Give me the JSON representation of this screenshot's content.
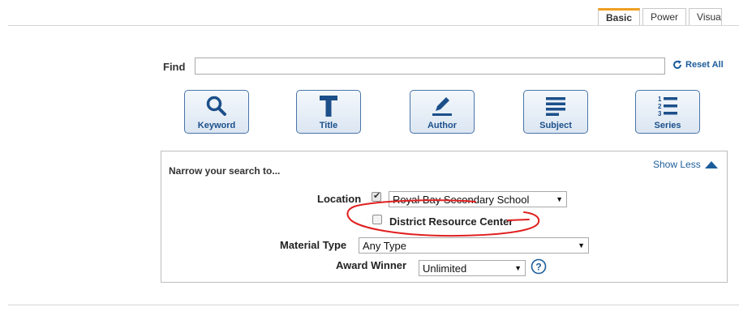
{
  "tabs": [
    {
      "label": "Basic",
      "active": true
    },
    {
      "label": "Power",
      "active": false
    },
    {
      "label": "Visua",
      "active": false
    }
  ],
  "find": {
    "label": "Find",
    "value": "",
    "placeholder": "",
    "reset_label": "Reset All",
    "reset_icon": "refresh-icon"
  },
  "search_types": [
    {
      "label": "Keyword",
      "icon": "magnifier-icon"
    },
    {
      "label": "Title",
      "icon": "letter-t-icon"
    },
    {
      "label": "Author",
      "icon": "pen-icon"
    },
    {
      "label": "Subject",
      "icon": "lines-icon"
    },
    {
      "label": "Series",
      "icon": "numbered-list-icon"
    }
  ],
  "narrow": {
    "title": "Narrow your search to...",
    "show_less": "Show Less",
    "location": {
      "label": "Location",
      "checked": true,
      "value": "Royal Bay Secondary School"
    },
    "district": {
      "label": "District Resource Center",
      "checked": false
    },
    "material_type": {
      "label": "Material Type",
      "value": "Any Type"
    },
    "award_winner": {
      "label": "Award Winner",
      "value": "Unlimited"
    }
  },
  "colors": {
    "accent": "#1c5d9b",
    "active_tab": "#f0a020",
    "annotation": "#e02020",
    "button_border": "#4a74a8"
  }
}
